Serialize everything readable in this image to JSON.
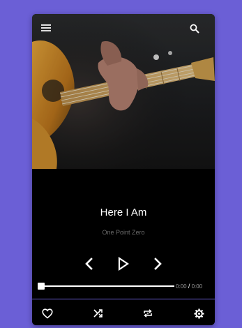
{
  "track": {
    "title": "Here I Am",
    "artist": "One Point Zero"
  },
  "player": {
    "elapsed": "0:00",
    "separator": "/",
    "duration": "0:00",
    "progress_fraction": 0
  },
  "icons": {
    "menu": "menu-icon",
    "search": "search-icon",
    "prev": "chevron-left-icon",
    "play": "play-icon",
    "next": "chevron-right-icon",
    "favorite": "heart-icon",
    "shuffle": "shuffle-icon",
    "repeat": "repeat-icon",
    "settings": "gear-icon"
  },
  "colors": {
    "background": "#6b5fd6",
    "player": "#000000",
    "accent": "#6b5fd6"
  }
}
